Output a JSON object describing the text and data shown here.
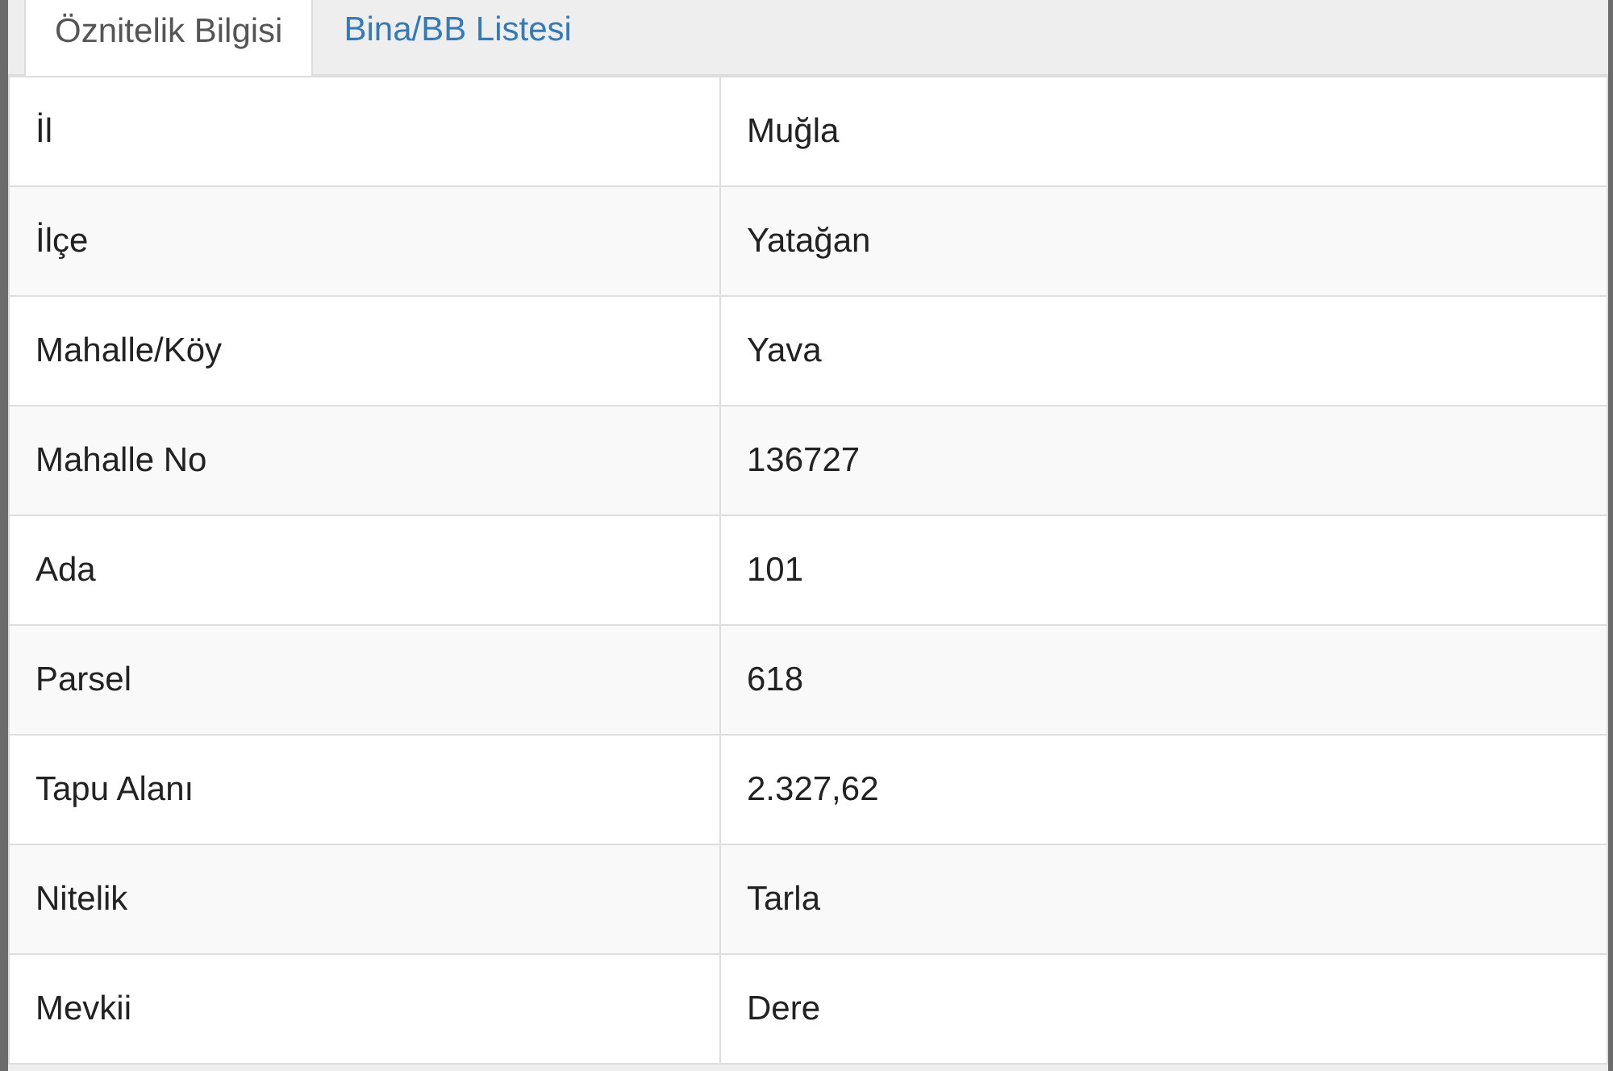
{
  "tabs": [
    {
      "label": "Öznitelik Bilgisi",
      "selected": true
    },
    {
      "label": "Bina/BB Listesi",
      "selected": false
    }
  ],
  "table": {
    "rows": [
      [
        "İl",
        "Muğla"
      ],
      [
        "İlçe",
        "Yatağan"
      ],
      [
        "Mahalle/Köy",
        "Yava"
      ],
      [
        "Mahalle No",
        "136727"
      ],
      [
        "Ada",
        "101"
      ],
      [
        "Parsel",
        "618"
      ],
      [
        "Tapu Alanı",
        "2.327,62"
      ],
      [
        "Nitelik",
        "Tarla"
      ],
      [
        "Mevkii",
        "Dere"
      ]
    ]
  }
}
